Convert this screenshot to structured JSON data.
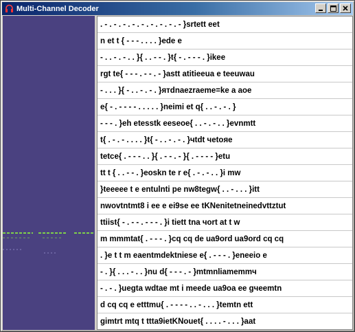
{
  "window": {
    "title": "Multi-Channel Decoder",
    "icon": "headphones-icon"
  },
  "controls": {
    "minimize": "minimize-icon",
    "maximize": "maximize-icon",
    "close": "close-icon"
  },
  "colors": {
    "spectrum_background": "#4a4180",
    "signal_marks": "#7fd24a",
    "title_gradient_start": "#0a246a",
    "title_gradient_end": "#a6caf0"
  },
  "decoded_lines": [
    ". - . - . - . - . - . - . - . - . - }srtett eet",
    "n et t { - - - . . . . }ede e",
    "- . . - . - . . }{ . . - - . }t{ - . - - - . }ikee",
    "rgt te{ - - - . - - . - }astt atitieeua e teeuwau",
    "- . . . }{ - . . - . - . }ятdnaezraeme=ke a aoe",
    "e{ - . - - - - . . . . . }neimi et q{ . . - . - . }",
    "- - - . }eh etesstk eeseoe{ . . - . - . . }evnmtt",
    "t{ . - . - . . . . }t{ - . . - . - . }чtdt чetoяe",
    "tetce{ . - - - . . }{ . - - . - }{ . - - - - }etu",
    "tt t { . . - - . }eoskn te r e{ . - . - . . }i mw",
    "}teeeee t e entulnti pe nw8tegw{ . . - . . . }itt",
    "nwovtntmt8 i ee e ei9se ee tKNenitetneinedvttztut",
    "ttiist{ - . - - . - - - . }i tiett tna чort at t w",
    "m mmmtat{ . - - - . }cq cq de ua9ord ua9ord cq cq",
    ". }e t t m eaentmdektniese e{ . - - - . }eneeio e",
    "- . }{ . . . - . . }nu d{ - - - . - }mtmnliamemmч",
    "- . - . }uegta wdtae mt i meede ua9oa ee gчeemtn",
    "d cq cq e etttmu{ . - - - - . . - . . . }temtn ett",
    "gimtrt mtq t ttta9ietKNouet{ . . . . - . . . }aat"
  ]
}
